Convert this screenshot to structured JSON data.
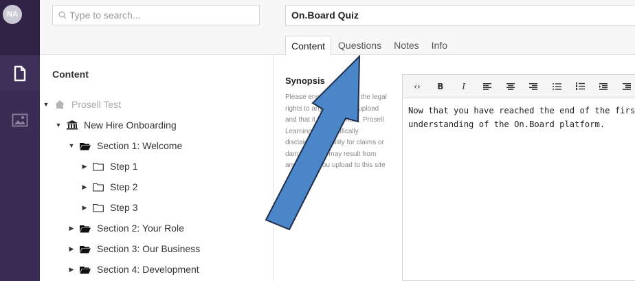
{
  "user": {
    "initials": "NA"
  },
  "rail": {
    "items": [
      {
        "icon": "document-icon"
      },
      {
        "icon": "image-icon"
      }
    ]
  },
  "search": {
    "placeholder": "Type to search..."
  },
  "tree": {
    "heading": "Content",
    "root": "Prosell Test",
    "course": "New Hire Onboarding",
    "nodes": [
      {
        "label": "Section 1: Welcome"
      },
      {
        "label": "Step 1"
      },
      {
        "label": "Step 2"
      },
      {
        "label": "Step 3"
      },
      {
        "label": "Section 2: Your Role"
      },
      {
        "label": "Section 3: Our Business"
      },
      {
        "label": "Section 4: Development"
      }
    ]
  },
  "editor": {
    "title": "On.Board Quiz",
    "tabs": [
      {
        "label": "Content"
      },
      {
        "label": "Questions"
      },
      {
        "label": "Notes"
      },
      {
        "label": "Info"
      }
    ],
    "synopsis_heading": "Synopsis",
    "synopsis_text": "Please ensure you have the legal rights to any media you upload and that it is appropriate. Prosell Learning Ltd specifically disclaims all liability for claims or damages that may result from any media you upload to this site",
    "toolbar": {
      "code": "‹›",
      "bold": "B",
      "italic": "I"
    },
    "body_line1": "Now that you have reached the end of the first se",
    "body_line2": "understanding of the On.Board platform."
  },
  "colors": {
    "rail": "#3b2c54",
    "arrow": "#4a86c8",
    "arrow_stroke": "#1f2d4a"
  }
}
